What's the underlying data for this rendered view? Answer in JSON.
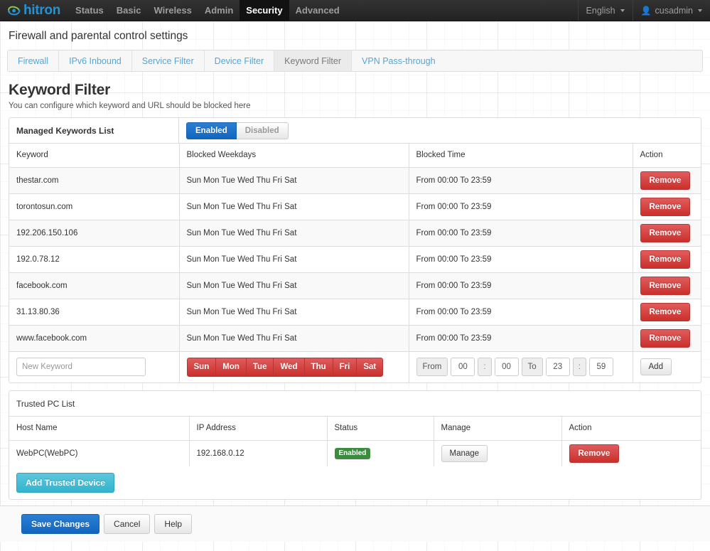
{
  "topnav": {
    "brand": "hitron",
    "brand_icon": "hitron-swirl-logo",
    "menu": [
      {
        "label": "Status",
        "active": false
      },
      {
        "label": "Basic",
        "active": false
      },
      {
        "label": "Wireless",
        "active": false
      },
      {
        "label": "Admin",
        "active": false
      },
      {
        "label": "Security",
        "active": true
      },
      {
        "label": "Advanced",
        "active": false
      }
    ],
    "language": "English",
    "user": "cusadmin",
    "user_icon": "user-icon",
    "caret_icon": "caret-down-icon"
  },
  "page": {
    "header": "Firewall and parental control settings",
    "title": "Keyword Filter",
    "subtitle": "You can configure which keyword and URL should be blocked here"
  },
  "subtabs": [
    {
      "label": "Firewall",
      "active": false
    },
    {
      "label": "IPv6 Inbound",
      "active": false
    },
    {
      "label": "Service Filter",
      "active": false
    },
    {
      "label": "Device Filter",
      "active": false
    },
    {
      "label": "Keyword Filter",
      "active": true
    },
    {
      "label": "VPN Pass-through",
      "active": false
    }
  ],
  "keyword_panel": {
    "title": "Managed Keywords List",
    "toggle": {
      "enabled_label": "Enabled",
      "disabled_label": "Disabled",
      "selected": "Enabled"
    },
    "columns": [
      "Keyword",
      "Blocked Weekdays",
      "Blocked Time",
      "Action"
    ],
    "rows": [
      {
        "keyword": "thestar.com",
        "weekdays": "Sun Mon Tue Wed Thu Fri Sat",
        "time": "From 00:00 To 23:59",
        "action": "Remove"
      },
      {
        "keyword": "torontosun.com",
        "weekdays": "Sun Mon Tue Wed Thu Fri Sat",
        "time": "From 00:00 To 23:59",
        "action": "Remove"
      },
      {
        "keyword": "192.206.150.106",
        "weekdays": "Sun Mon Tue Wed Thu Fri Sat",
        "time": "From 00:00 To 23:59",
        "action": "Remove"
      },
      {
        "keyword": "192.0.78.12",
        "weekdays": "Sun Mon Tue Wed Thu Fri Sat",
        "time": "From 00:00 To 23:59",
        "action": "Remove"
      },
      {
        "keyword": "facebook.com",
        "weekdays": "Sun Mon Tue Wed Thu Fri Sat",
        "time": "From 00:00 To 23:59",
        "action": "Remove"
      },
      {
        "keyword": "31.13.80.36",
        "weekdays": "Sun Mon Tue Wed Thu Fri Sat",
        "time": "From 00:00 To 23:59",
        "action": "Remove"
      },
      {
        "keyword": "www.facebook.com",
        "weekdays": "Sun Mon Tue Wed Thu Fri Sat",
        "time": "From 00:00 To 23:59",
        "action": "Remove"
      }
    ],
    "new_row": {
      "keyword_value": "",
      "keyword_placeholder": "New Keyword",
      "days": [
        {
          "label": "Sun",
          "selected": true
        },
        {
          "label": "Mon",
          "selected": true
        },
        {
          "label": "Tue",
          "selected": true
        },
        {
          "label": "Wed",
          "selected": true
        },
        {
          "label": "Thu",
          "selected": true
        },
        {
          "label": "Fri",
          "selected": true
        },
        {
          "label": "Sat",
          "selected": true
        }
      ],
      "from_label": "From",
      "from_hour": "00",
      "from_minute": "00",
      "to_label": "To",
      "to_hour": "23",
      "to_minute": "59",
      "colon": ":",
      "add_label": "Add"
    }
  },
  "trusted_panel": {
    "title": "Trusted PC List",
    "columns": [
      "Host Name",
      "IP Address",
      "Status",
      "Manage",
      "Action"
    ],
    "rows": [
      {
        "host": "WebPC(WebPC)",
        "ip": "192.168.0.12",
        "status": "Enabled",
        "manage": "Manage",
        "action": "Remove"
      }
    ],
    "add_label": "Add Trusted Device"
  },
  "footer": {
    "save_label": "Save Changes",
    "cancel_label": "Cancel",
    "help_label": "Help"
  },
  "colors": {
    "brand_blue": "#2492d6",
    "primary": "#1266c0",
    "danger": "#c9302c",
    "info": "#34b3ce",
    "success": "#3c8c40",
    "link": "#4fa8dc",
    "navbar": "#222222"
  }
}
